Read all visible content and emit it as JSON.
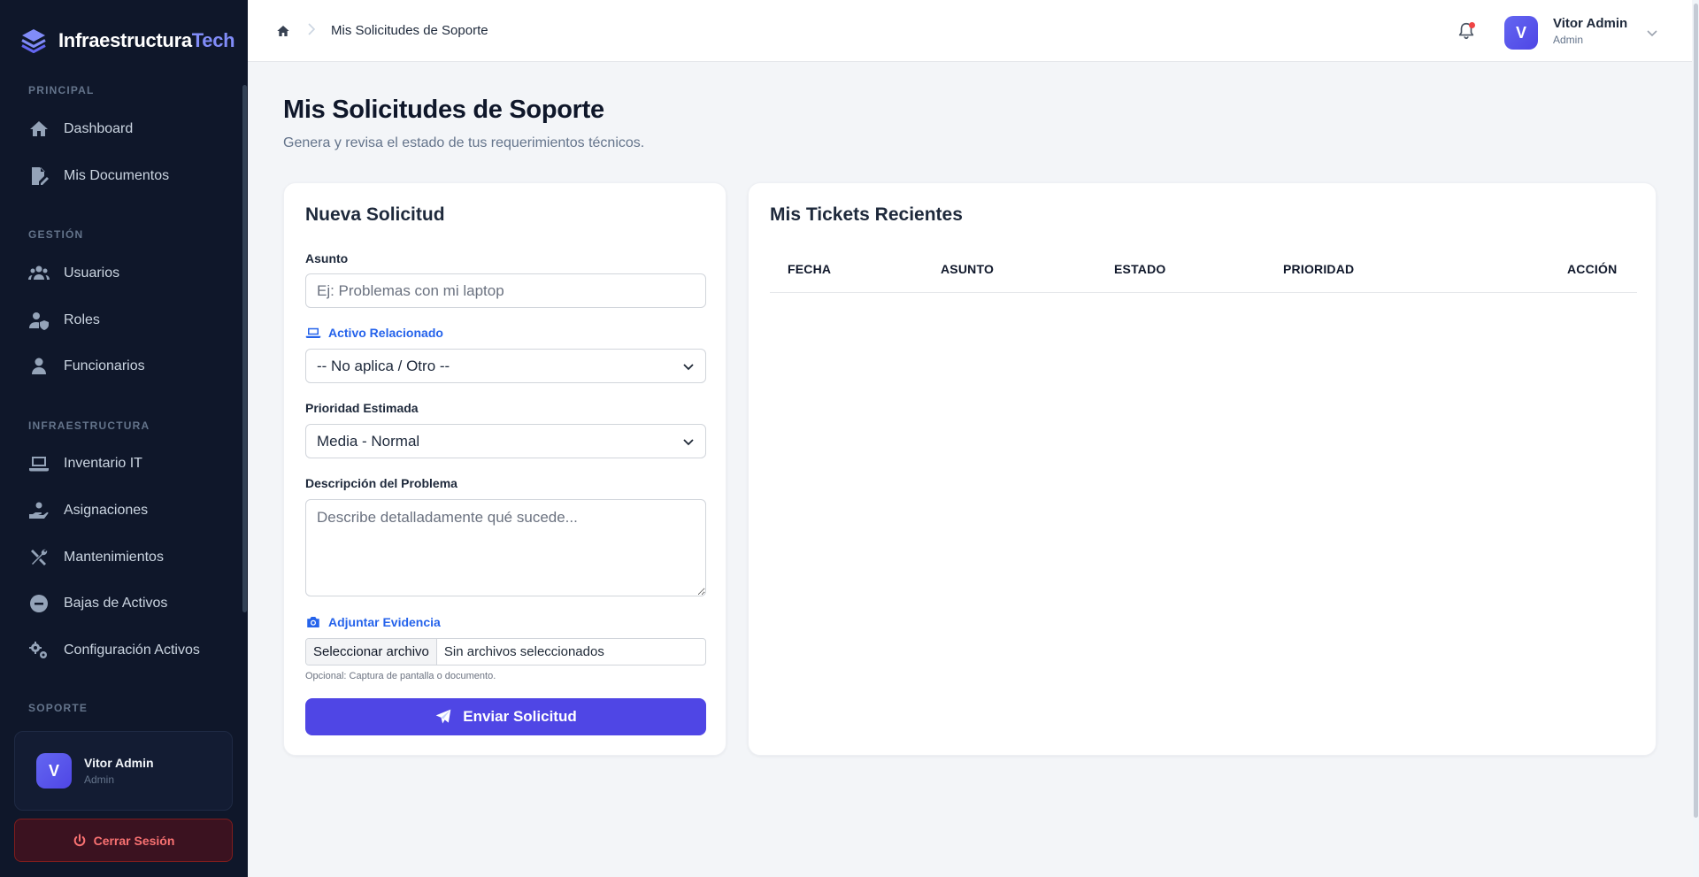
{
  "brand": {
    "name_main": "Infraestructura",
    "name_accent": "Tech"
  },
  "sidebar": {
    "sections": {
      "principal": "PRINCIPAL",
      "gestion": "GESTIÓN",
      "infraestructura": "INFRAESTRUCTURA",
      "soporte": "SOPORTE"
    },
    "items": [
      {
        "label": "Dashboard",
        "icon": "home-icon"
      },
      {
        "label": "Mis Documentos",
        "icon": "file-signature-icon"
      },
      {
        "label": "Usuarios",
        "icon": "users-icon"
      },
      {
        "label": "Roles",
        "icon": "user-shield-icon"
      },
      {
        "label": "Funcionarios",
        "icon": "user-icon"
      },
      {
        "label": "Inventario IT",
        "icon": "laptop-icon"
      },
      {
        "label": "Asignaciones",
        "icon": "hand-holding-icon"
      },
      {
        "label": "Mantenimientos",
        "icon": "tools-icon"
      },
      {
        "label": "Bajas de Activos",
        "icon": "minus-circle-icon"
      },
      {
        "label": "Configuración Activos",
        "icon": "gears-icon"
      }
    ],
    "user": {
      "initial": "V",
      "name": "Vitor Admin",
      "role": "Admin"
    },
    "logout_label": "Cerrar Sesión"
  },
  "topbar": {
    "breadcrumb_current": "Mis Solicitudes de Soporte",
    "user": {
      "initial": "V",
      "name": "Vitor Admin",
      "role": "Admin"
    }
  },
  "page": {
    "title": "Mis Solicitudes de Soporte",
    "subtitle": "Genera y revisa el estado de tus requerimientos técnicos."
  },
  "form": {
    "title": "Nueva Solicitud",
    "subject_label": "Asunto",
    "subject_placeholder": "Ej: Problemas con mi laptop",
    "asset_label": "Activo Relacionado",
    "asset_value": "-- No aplica / Otro --",
    "priority_label": "Prioridad Estimada",
    "priority_value": "Media - Normal",
    "description_label": "Descripción del Problema",
    "description_placeholder": "Describe detalladamente qué sucede...",
    "evidence_label": "Adjuntar Evidencia",
    "file_button": "Seleccionar archivo",
    "file_status": "Sin archivos seleccionados",
    "file_hint": "Opcional: Captura de pantalla o documento.",
    "submit_label": "Enviar Solicitud"
  },
  "tickets": {
    "title": "Mis Tickets Recientes",
    "columns": [
      "FECHA",
      "ASUNTO",
      "ESTADO",
      "PRIORIDAD",
      "ACCIÓN"
    ],
    "rows": []
  },
  "colors": {
    "sidebar_bg": "#0f172a",
    "accent": "#4f46e5",
    "link_blue": "#2563eb",
    "danger": "#f87171"
  }
}
